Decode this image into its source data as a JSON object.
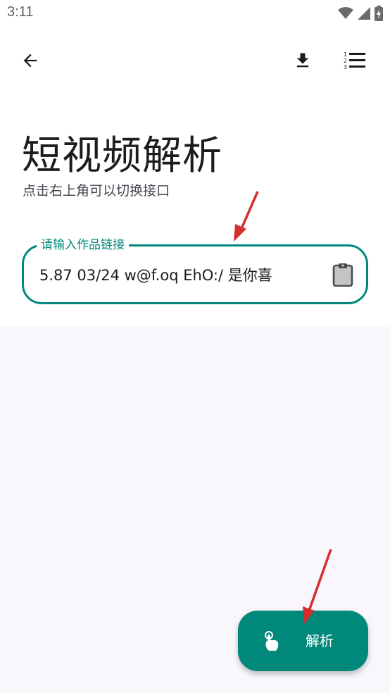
{
  "status_bar": {
    "time": "3:11",
    "icons": [
      "wifi-icon",
      "signal-icon",
      "battery-charging-icon"
    ]
  },
  "app_bar": {
    "back_icon": "arrow-left-icon",
    "download_icon": "download-icon",
    "list_icon": "numbered-list-icon"
  },
  "header": {
    "title": "短视频解析",
    "subtitle": "点击右上角可以切换接口"
  },
  "link_input": {
    "label": "请输入作品链接",
    "value": "5.87 03/24 w@f.oq EhO:/ 是你喜",
    "paste_icon": "clipboard-icon"
  },
  "fab": {
    "label": "解析",
    "icon": "touch-hand-icon"
  },
  "colors": {
    "accent": "#00897b",
    "annotation_arrow": "#d32f2f",
    "background": "#faf7fc"
  }
}
